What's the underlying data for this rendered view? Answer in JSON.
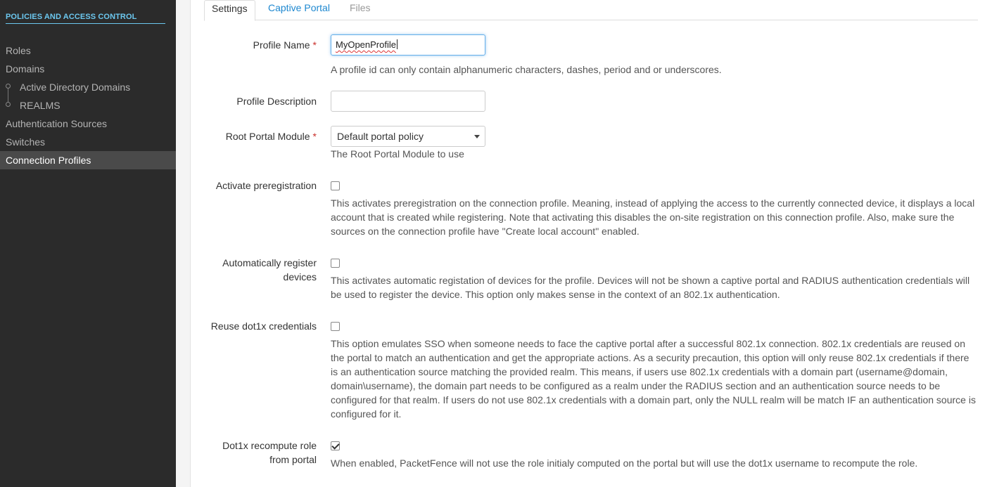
{
  "sidebar": {
    "section_title": "POLICIES AND ACCESS CONTROL",
    "items": [
      {
        "label": "Roles"
      },
      {
        "label": "Domains"
      },
      {
        "label": "Active Directory Domains"
      },
      {
        "label": "REALMS"
      },
      {
        "label": "Authentication Sources"
      },
      {
        "label": "Switches"
      },
      {
        "label": "Connection Profiles"
      }
    ],
    "active_item": "Connection Profiles"
  },
  "tabs": [
    {
      "label": "Settings",
      "state": "active"
    },
    {
      "label": "Captive Portal",
      "state": "link"
    },
    {
      "label": "Files",
      "state": "muted"
    }
  ],
  "form": {
    "profile_name": {
      "label": "Profile Name",
      "required_mark": "*",
      "value": "MyOpenProfile",
      "help": "A profile id can only contain alphanumeric characters, dashes, period and or underscores."
    },
    "profile_description": {
      "label": "Profile Description",
      "value": ""
    },
    "root_portal_module": {
      "label": "Root Portal Module",
      "required_mark": "*",
      "selected": "Default portal policy",
      "help": "The Root Portal Module to use"
    },
    "activate_preregistration": {
      "label": "Activate preregistration",
      "checked": false,
      "help": "This activates preregistration on the connection profile. Meaning, instead of applying the access to the currently connected device, it displays a local account that is created while registering. Note that activating this disables the on-site registration on this connection profile. Also, make sure the sources on the connection profile have \"Create local account\" enabled."
    },
    "auto_register": {
      "label_line1": "Automatically register",
      "label_line2": "devices",
      "checked": false,
      "help": "This activates automatic registation of devices for the profile. Devices will not be shown a captive portal and RADIUS authentication credentials will be used to register the device. This option only makes sense in the context of an 802.1x authentication."
    },
    "reuse_dot1x": {
      "label": "Reuse dot1x credentials",
      "checked": false,
      "help": "This option emulates SSO when someone needs to face the captive portal after a successful 802.1x connection. 802.1x credentials are reused on the portal to match an authentication and get the appropriate actions. As a security precaution, this option will only reuse 802.1x credentials if there is an authentication source matching the provided realm. This means, if users use 802.1x credentials with a domain part (username@domain, domain\\username), the domain part needs to be configured as a realm under the RADIUS section and an authentication source needs to be configured for that realm. If users do not use 802.1x credentials with a domain part, only the NULL realm will be match IF an authentication source is configured for it."
    },
    "dot1x_recompute": {
      "label_line1": "Dot1x recompute role",
      "label_line2": "from portal",
      "checked": true,
      "help": "When enabled, PacketFence will not use the role initialy computed on the portal but will use the dot1x username to recompute the role."
    }
  },
  "colors": {
    "sidebar_bg": "#2b2b2b",
    "sidebar_title": "#6cc8f0",
    "link": "#1e88d0",
    "required": "#c9302c"
  }
}
